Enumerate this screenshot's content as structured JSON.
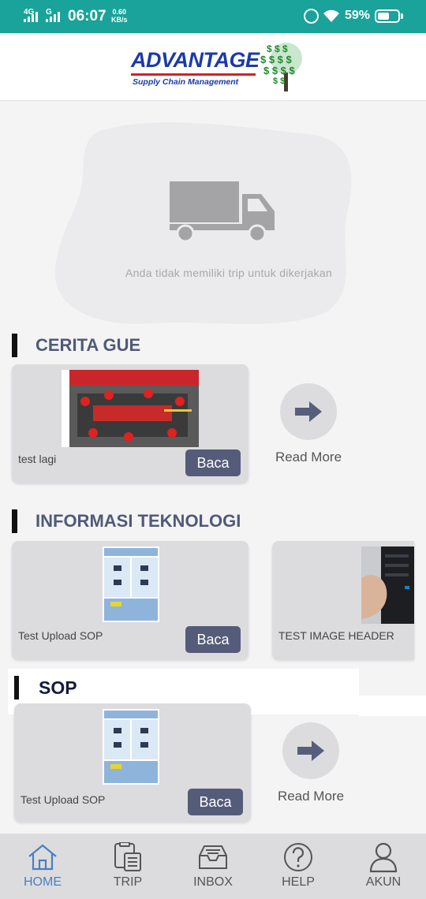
{
  "status_bar": {
    "network_1": "4G",
    "network_2": "G",
    "time": "06:07",
    "speed_value": "0.60",
    "speed_unit": "KB/s",
    "battery_text": "59%",
    "battery_level": 0.59
  },
  "header": {
    "logo_word": "ADVANTAGE",
    "logo_sub": "Supply Chain Management"
  },
  "empty_trip": {
    "message": "Anda tidak memiliki trip untuk dikerjakan"
  },
  "sections": {
    "cerita": {
      "title": "CERITA GUE",
      "cards": [
        {
          "title": "test lagi",
          "button": "Baca"
        }
      ],
      "more_label": "Read More"
    },
    "teknologi": {
      "title": "INFORMASI TEKNOLOGI",
      "cards": [
        {
          "title": "Test Upload SOP",
          "button": "Baca"
        },
        {
          "title": "TEST IMAGE HEADER"
        }
      ]
    },
    "sop": {
      "title": "SOP",
      "cards": [
        {
          "title": "Test Upload SOP",
          "button": "Baca"
        }
      ],
      "more_label": "Read More"
    }
  },
  "bottom_nav": {
    "items": [
      {
        "label": "HOME",
        "icon": "home-icon",
        "active": true
      },
      {
        "label": "TRIP",
        "icon": "trip-icon",
        "active": false
      },
      {
        "label": "INBOX",
        "icon": "inbox-icon",
        "active": false
      },
      {
        "label": "HELP",
        "icon": "help-icon",
        "active": false
      },
      {
        "label": "AKUN",
        "icon": "account-icon",
        "active": false
      }
    ]
  },
  "colors": {
    "status_bar": "#19a39a",
    "accent_button": "#555c7a",
    "active_nav": "#4a7fc0",
    "section_title": "#505a78"
  }
}
